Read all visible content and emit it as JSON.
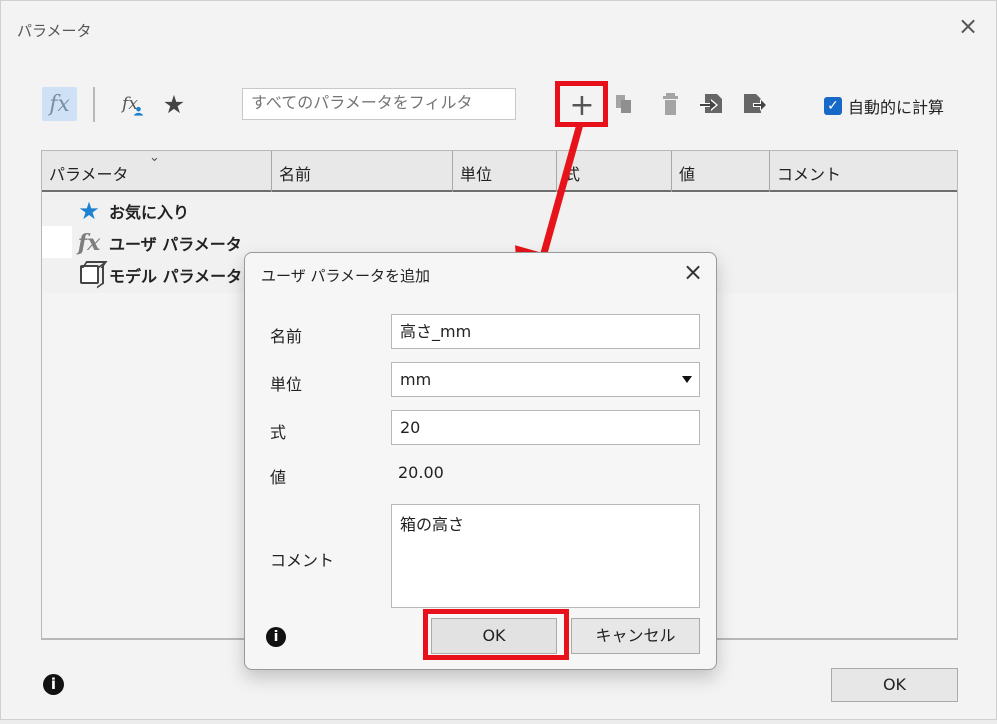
{
  "window": {
    "title": "パラメータ",
    "close_symbol": "×"
  },
  "toolbar": {
    "fx_label": "fx",
    "user_fx_label": "fx",
    "favorite_symbol": "★",
    "filter_placeholder": "すべてのパラメータをフィルタ",
    "add_symbol": "+",
    "auto_calculate_label": "自動的に計算",
    "checkbox_mark": "✓"
  },
  "table": {
    "columns": [
      "パラメータ",
      "名前",
      "単位",
      "式",
      "値",
      "コメント"
    ],
    "tree": [
      {
        "label": "お気に入り",
        "icon": "star-icon"
      },
      {
        "label": "ユーザ パラメータ",
        "icon": "fx-icon"
      },
      {
        "label": "モデル パラメータ",
        "icon": "cube-icon"
      }
    ]
  },
  "main_footer": {
    "info_symbol": "i",
    "ok_label": "OK"
  },
  "dialog": {
    "title": "ユーザ パラメータを追加",
    "close_symbol": "×",
    "name_label": "名前",
    "name_value": "高さ_mm",
    "unit_label": "単位",
    "unit_value": "mm",
    "expression_label": "式",
    "expression_value": "20",
    "value_label": "値",
    "value_value": "20.00",
    "comment_label": "コメント",
    "comment_value": "箱の高さ",
    "info_symbol": "i",
    "ok_label": "OK",
    "cancel_label": "キャンセル"
  },
  "colors": {
    "accent_red": "#e8111b",
    "blue": "#1f82d0",
    "checkbox_blue": "#1669c7"
  }
}
